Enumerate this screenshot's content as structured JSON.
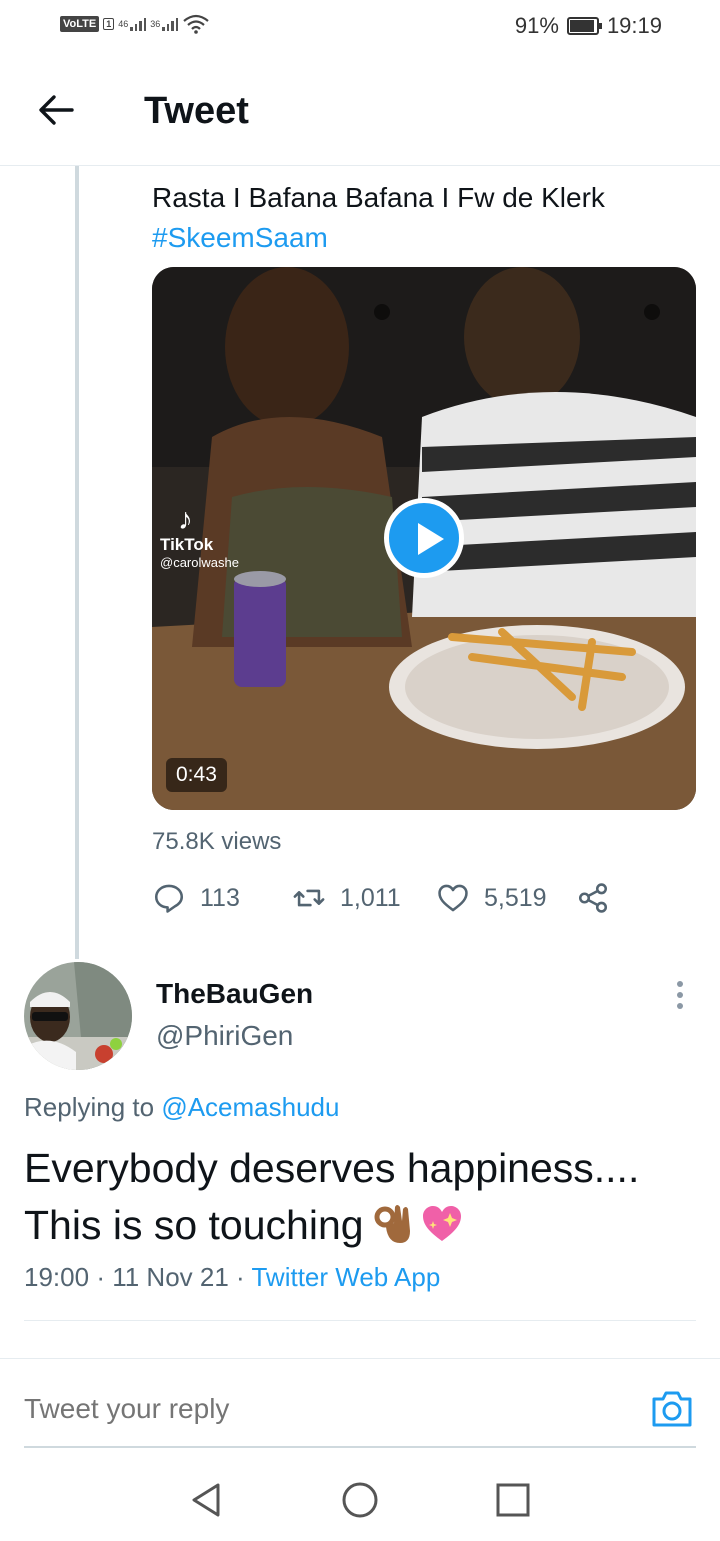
{
  "status_bar": {
    "volte": "VoLTE",
    "sim": "1",
    "net1": "46",
    "net2": "36",
    "battery": "91%",
    "time": "19:19"
  },
  "header": {
    "title": "Tweet"
  },
  "parent_tweet": {
    "text": "Rasta I Bafana Bafana I Fw de Klerk",
    "hashtag": "#SkeemSaam",
    "video": {
      "duration": "0:43",
      "watermark_brand": "TikTok",
      "watermark_user": "@carolwashe"
    },
    "views": "75.8K views",
    "replies": "113",
    "retweets": "1,011",
    "likes": "5,519"
  },
  "reply_tweet": {
    "display_name": "TheBauGen",
    "handle": "@PhiriGen",
    "replying_prefix": "Replying to",
    "replying_to": "@Acemashudu",
    "body_line1": "Everybody deserves happiness....",
    "body_line2": "This is so touching",
    "emojis": [
      "ok-hand",
      "sparkling-heart"
    ],
    "time": "19:00",
    "date": "11 Nov 21",
    "source": "Twitter Web App",
    "sep": "·"
  },
  "reply_bar": {
    "placeholder": "Tweet your reply"
  },
  "colors": {
    "accent": "#1d9bf0",
    "muted": "#536471",
    "text": "#0f1419"
  }
}
